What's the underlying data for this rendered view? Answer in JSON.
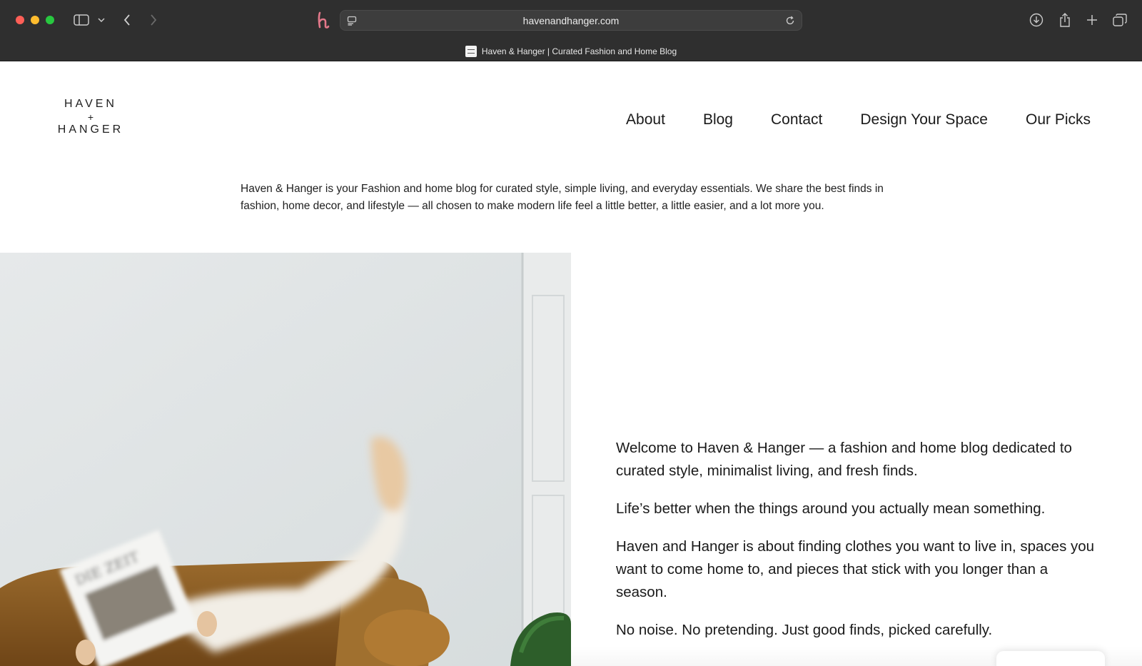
{
  "browser": {
    "url": "havenandhanger.com",
    "tab_title": "Haven & Hanger | Curated Fashion and Home Blog"
  },
  "site": {
    "logo": {
      "line1": "HAVEN",
      "line2": "+",
      "line3": "HANGER"
    },
    "nav": [
      {
        "label": "About"
      },
      {
        "label": "Blog"
      },
      {
        "label": "Contact"
      },
      {
        "label": "Design Your Space"
      },
      {
        "label": "Our Picks"
      }
    ],
    "intro": "Haven & Hanger is your Fashion and home blog for curated style, simple living, and everyday essentials. We share the best finds in fashion, home decor, and lifestyle — all chosen to make modern life feel a little better, a little easier, and a lot more you.",
    "hero_image_icon": "person-reading-newspaper-on-sofa-photo",
    "hero_newspaper_text": "DIE ZEIT",
    "welcome": [
      "Welcome to Haven & Hanger — a fashion and home blog dedicated to curated style, minimalist living, and fresh finds.",
      "Life’s better when the things around you actually mean something.",
      "Haven and Hanger is about finding clothes you want to live in, spaces you want to come home to, and pieces that stick with you longer than a season.",
      "No noise. No pretending. Just good finds, picked carefully."
    ]
  },
  "colors": {
    "chrome_bg": "#2f2f2f",
    "page_bg": "#ffffff",
    "text": "#1a1a1a",
    "sofa": "#8a5a22"
  }
}
